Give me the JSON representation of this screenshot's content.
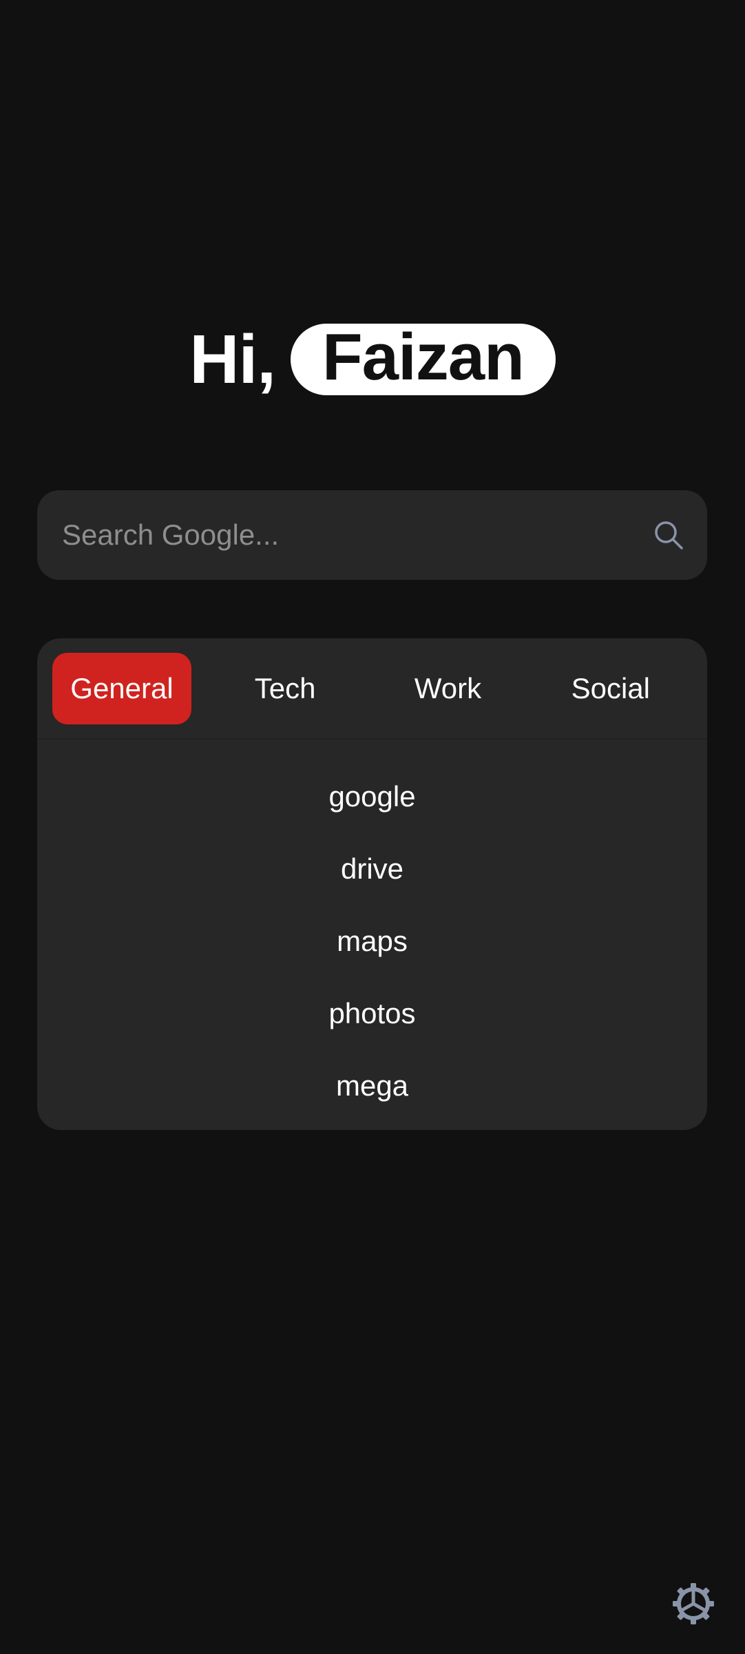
{
  "greeting": {
    "prefix": "Hi,",
    "name": "Faizan"
  },
  "search": {
    "placeholder": "Search Google...",
    "value": "",
    "icon": "search-icon"
  },
  "tabs": [
    {
      "label": "General",
      "active": true
    },
    {
      "label": "Tech",
      "active": false
    },
    {
      "label": "Work",
      "active": false
    },
    {
      "label": "Social",
      "active": false
    }
  ],
  "links": [
    {
      "label": "google"
    },
    {
      "label": "drive"
    },
    {
      "label": "maps"
    },
    {
      "label": "photos"
    },
    {
      "label": "mega"
    }
  ],
  "settings": {
    "icon": "gear-icon"
  },
  "colors": {
    "background": "#111111",
    "surface": "#272727",
    "accent": "#d0231f",
    "text": "#ffffff",
    "muted": "#8e8e8e",
    "icon": "#8a94a8"
  }
}
